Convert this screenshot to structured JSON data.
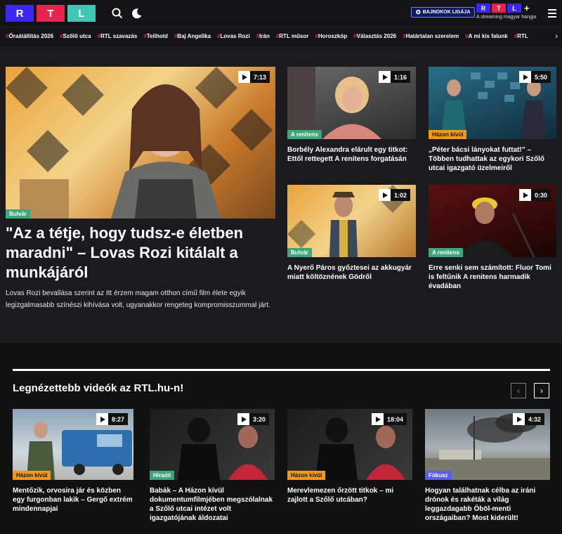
{
  "header": {
    "logo": [
      "R",
      "T",
      "L"
    ],
    "icons": [
      "search-icon",
      "moon-icon",
      "menu-icon"
    ],
    "bl_label": "BAJNOKOK LIGÁJA",
    "rtlplus": {
      "letters": [
        "R",
        "T",
        "L"
      ],
      "plus": "+",
      "tagline": "A streaming magyar hangja"
    }
  },
  "tags": [
    "Óraátállítás 2026",
    "Szőlő utca",
    "RTL szavazás",
    "Telihold",
    "Baj Angelika",
    "Lovas Rozi",
    "Irán",
    "RTL műsor",
    "Horoszkóp",
    "Választás 2026",
    "Határtalan szerelem",
    "A mi kis falunk",
    "RTL"
  ],
  "hero": {
    "duration": "7:13",
    "badge": "Bulvár",
    "title": "\"Az a tétje, hogy tudsz-e életben maradni\" – Lovas Rozi kitálalt a munkájáról",
    "lead": "Lovas Rozi bevallása szerint az Itt érzem magam otthon című film élete egyik legizgalmasabb színészi kihívása volt, ugyanakkor rengeteg kompromisszummal járt."
  },
  "grid": [
    {
      "duration": "1:16",
      "badge": "A renitens",
      "title": "Borbély Alexandra elárult egy titkot: Ettől rettegett A renitens forgatásán"
    },
    {
      "duration": "5:50",
      "badge": "Házon kívül",
      "title": "„Péter bácsi lányokat futtat!” – Többen tudhattak az egykori Szőlő utcai igazgató üzelmeiről"
    },
    {
      "duration": "1:02",
      "badge": "Bulvár",
      "title": "A Nyerő Páros győztesei az akkugyár miatt költöznének Gödről"
    },
    {
      "duration": "0:30",
      "badge": "A renitens",
      "title": "Erre senki sem számított: Fluor Tomi is feltűnik A renitens harmadik évadában"
    }
  ],
  "section": {
    "title": "Legnézettebb videók az RTL.hu-n!",
    "prev": "‹",
    "next": "›",
    "videos": [
      {
        "duration": "8:27",
        "badge": "Házon kívül",
        "title": "Mentőzik, orvosira jár és közben egy furgonban lakik – Gergő extrém mindennapjai"
      },
      {
        "duration": "3:20",
        "badge": "Híradó",
        "title": "Babák – A Házon kívül dokumentumfilmjében megszólalnak a Szőlő utcai intézet volt igazgatójának áldozatai"
      },
      {
        "duration": "18:04",
        "badge": "Házon kívül",
        "title": "Merevlemezen őrzött titkok – mi zajlott a Szőlő utcában?"
      },
      {
        "duration": "4:32",
        "badge": "Fókusz",
        "title": "Hogyan találhatnak célba az iráni drónok és rakéták a világ leggazdagabb Öböl-menti országaiban? Most kiderült!"
      }
    ]
  },
  "colors": {
    "rtl_blue": "#3a27f5",
    "rtl_red": "#e8244e",
    "rtl_teal": "#3fc7b4",
    "badge_green": "#3fa57a",
    "badge_orange": "#f09a1a",
    "badge_blue": "#5b5cf5"
  }
}
